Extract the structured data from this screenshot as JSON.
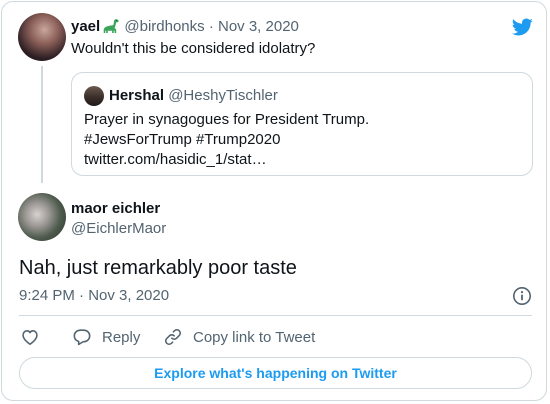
{
  "parent_tweet": {
    "name": "yael",
    "handle": "@birdhonks",
    "separator": "·",
    "date": "Nov 3, 2020",
    "text": "Wouldn't this be considered idolatry?"
  },
  "quoted_tweet": {
    "name": "Hershal",
    "handle": "@HeshyTischler",
    "lines": [
      "Prayer in synagogues for President Trump.",
      "#JewsForTrump #Trump2020",
      " twitter.com/hasidic_1/stat…"
    ]
  },
  "main_tweet": {
    "name": "maor eichler",
    "handle": "@EichlerMaor",
    "text": "Nah, just remarkably poor taste",
    "timestamp": "9:24 PM · Nov 3, 2020"
  },
  "actions": {
    "reply_label": "Reply",
    "copy_label": "Copy link to Tweet"
  },
  "footer": {
    "explore_label": "Explore what's happening on Twitter"
  },
  "icons": {
    "brand": "twitter-bird-icon",
    "name_emoji": "sauropod-emoji-icon",
    "info": "info-icon",
    "like": "heart-icon",
    "reply": "speech-bubble-icon",
    "copy": "link-icon"
  },
  "colors": {
    "brand_blue": "#1d9bf0",
    "text_primary": "#0f1419",
    "text_muted": "#536471",
    "border": "#cfd9de"
  }
}
